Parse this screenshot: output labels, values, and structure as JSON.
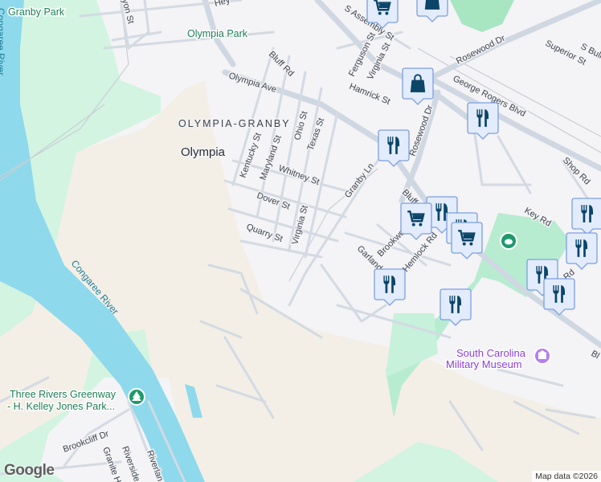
{
  "map": {
    "neighborhood": "OLYMPIA-GRANBY",
    "place": "Olympia",
    "parks": [
      "Granby Park",
      "Olympia Park",
      "Three Rivers Greenway",
      "- H. Kelley Jones Park..."
    ],
    "water": [
      "Congaree River",
      "Congaree River"
    ],
    "landmarks": [
      "South Carolina",
      "Military Museum"
    ],
    "streets": {
      "s_assembly": "S Assembly St",
      "rosewood_dr_ne": "Rosewood Dr",
      "rosewood_dr": "Rosewood Dr",
      "superior": "Superior St",
      "s_bull": "S Bull",
      "george_rogers": "George Rogers Blvd",
      "olympia_ave": "Olympia Ave",
      "bluff_rd_n": "Bluff Rd",
      "bluff": "Bluff",
      "ferguson": "Ferguson St",
      "virginia_n": "Virginia St",
      "hamrick": "Hamrick St",
      "ohio": "Ohio St",
      "texas": "Texas St",
      "kentucky": "Kentucky St",
      "maryland": "Maryland St",
      "whitney": "Whitney St",
      "dover": "Dover St",
      "quarry": "Quarry St",
      "virginia_s": "Virginia St",
      "granby_ln": "Granby Ln",
      "shop_rd": "Shop Rd",
      "key_rd": "Key Rd",
      "garland": "Garland St",
      "brookwood": "Brookwo",
      "hemlock": "Hemlock Rd",
      "heyward": "Hey",
      "lyon": "yon St",
      "brookcliff": "Brookcliff Dr",
      "granite": "Granite Hi",
      "riverside": "Riverside",
      "riverland": "Riverlan",
      "bl_edge": "Bl",
      "rd_edge": "Rd"
    },
    "pins": [
      {
        "type": "shopping-cart"
      },
      {
        "type": "shopping-bag"
      },
      {
        "type": "shopping-bag"
      },
      {
        "type": "restaurant"
      },
      {
        "type": "restaurant"
      },
      {
        "type": "restaurant"
      },
      {
        "type": "restaurant"
      },
      {
        "type": "shopping-cart"
      },
      {
        "type": "shopping-cart"
      },
      {
        "type": "restaurant"
      },
      {
        "type": "restaurant"
      },
      {
        "type": "restaurant"
      },
      {
        "type": "restaurant"
      },
      {
        "type": "restaurant"
      },
      {
        "type": "restaurant"
      }
    ],
    "colors": {
      "water": "#8fd9ec",
      "park": "#cff3df",
      "land": "#f3efe6",
      "pin": "#0b4568"
    }
  },
  "footer": {
    "logo": "Google",
    "attribution": "Map data ©2026"
  }
}
